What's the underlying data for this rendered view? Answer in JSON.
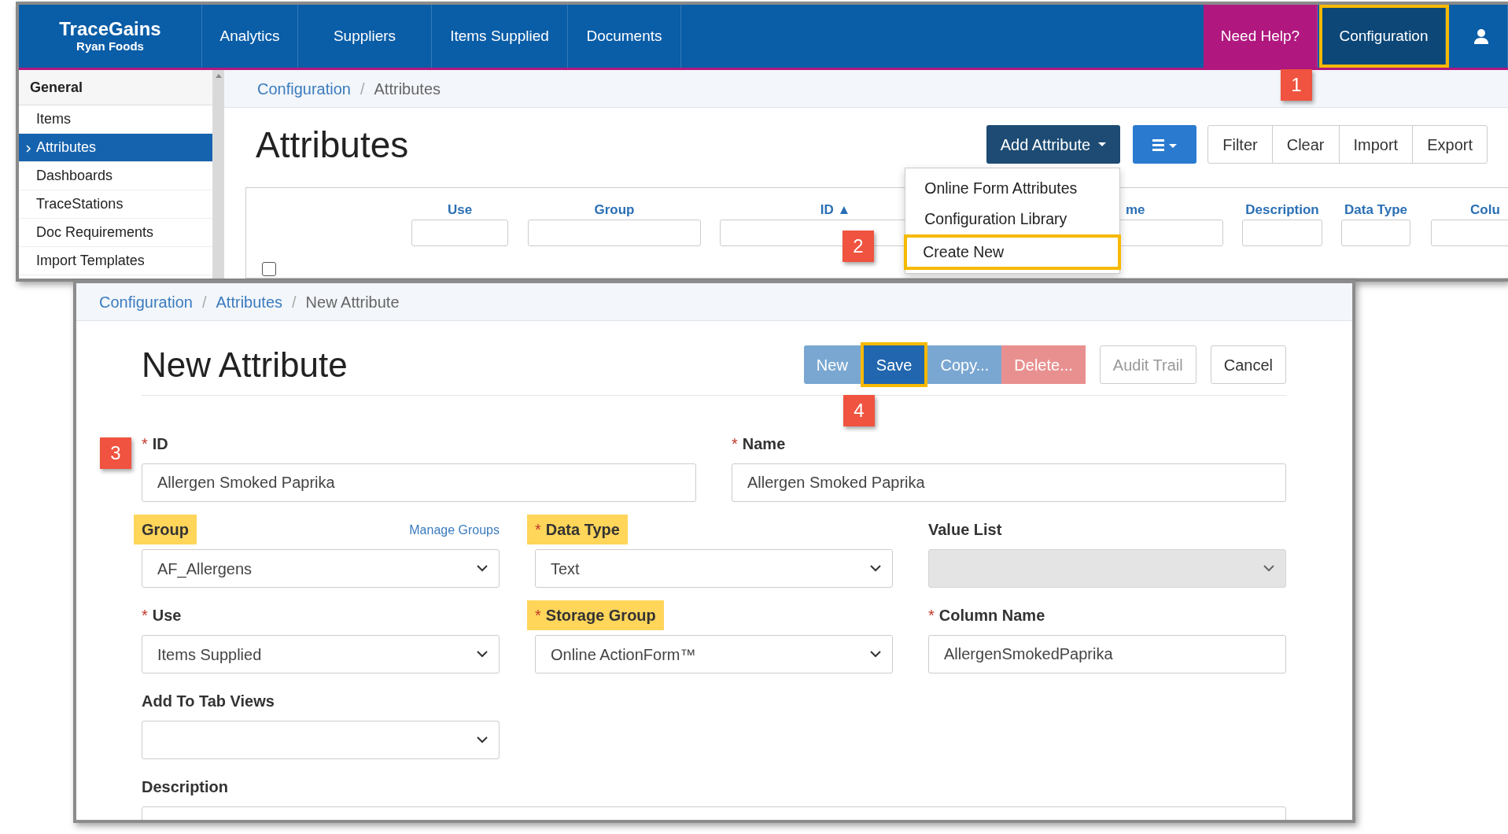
{
  "top_window": {
    "brand": {
      "name": "TraceGains",
      "org": "Ryan Foods"
    },
    "nav": [
      {
        "label": "Analytics"
      },
      {
        "label": "Suppliers"
      },
      {
        "label": "Items Supplied"
      },
      {
        "label": "Documents"
      }
    ],
    "nav_right": [
      {
        "kind": "help",
        "label": "Need Help?",
        "selected": false,
        "highlighted": false
      },
      {
        "kind": "link",
        "label": "Configuration",
        "selected": true,
        "highlighted": true
      },
      {
        "kind": "user",
        "selected": false,
        "highlighted": false
      }
    ],
    "sidebar": {
      "heading": "General",
      "items": [
        {
          "label": "Items",
          "selected": false
        },
        {
          "label": "Attributes",
          "selected": true
        },
        {
          "label": "Dashboards",
          "selected": false
        },
        {
          "label": "TraceStations",
          "selected": false
        },
        {
          "label": "Doc Requirements",
          "selected": false
        },
        {
          "label": "Import Templates",
          "selected": false
        }
      ]
    },
    "breadcrumb": [
      {
        "label": "Configuration",
        "link": true
      },
      {
        "label": "Attributes",
        "link": false
      }
    ],
    "breadcrumb_separator": "/",
    "title": "Attributes",
    "add_button": {
      "label": "Add Attribute",
      "expanded": true
    },
    "menu": [
      {
        "label": "Online Form Attributes",
        "highlighted": false
      },
      {
        "label": "Configuration Library",
        "highlighted": false
      },
      {
        "label": "Create New",
        "highlighted": true
      }
    ],
    "actions": [
      {
        "label": "Filter"
      },
      {
        "label": "Clear"
      },
      {
        "label": "Import"
      },
      {
        "label": "Export"
      }
    ],
    "columns": [
      {
        "label": "Use"
      },
      {
        "label": "Group"
      },
      {
        "label": "ID ▲"
      },
      {
        "label": "me"
      },
      {
        "label": "Description"
      },
      {
        "label": "Data Type"
      },
      {
        "label": "Colu"
      }
    ],
    "select_all": {
      "checked": false
    }
  },
  "form_window": {
    "breadcrumb": [
      {
        "label": "Configuration",
        "link": true
      },
      {
        "label": "Attributes",
        "link": true
      },
      {
        "label": "New Attribute",
        "link": false
      }
    ],
    "breadcrumb_separator": "/",
    "title": "New Attribute",
    "buttons": [
      {
        "label": "New",
        "kind": "primary",
        "disabled": true,
        "highlighted": false
      },
      {
        "label": "Save",
        "kind": "primary",
        "disabled": false,
        "highlighted": true
      },
      {
        "label": "Copy...",
        "kind": "primary",
        "disabled": true,
        "highlighted": false
      },
      {
        "label": "Delete...",
        "kind": "danger",
        "disabled": true,
        "highlighted": false
      },
      {
        "label": "Audit Trail",
        "kind": "default",
        "disabled": true,
        "highlighted": false
      },
      {
        "label": "Cancel",
        "kind": "default",
        "disabled": false,
        "highlighted": false
      }
    ],
    "required_mark": "*",
    "fields": [
      {
        "label": "ID",
        "kind": "input",
        "required": true,
        "highlighted": false,
        "value": "Allergen Smoked Paprika",
        "disabled": false
      },
      {
        "label": "Name",
        "kind": "input",
        "required": true,
        "highlighted": false,
        "value": "Allergen Smoked Paprika",
        "disabled": false
      },
      {
        "label": "Group",
        "kind": "select",
        "required": false,
        "highlighted": true,
        "value": "AF_Allergens",
        "link": "Manage Groups",
        "disabled": false
      },
      {
        "label": "Data Type",
        "kind": "select",
        "required": true,
        "highlighted": true,
        "value": "Text",
        "disabled": false
      },
      {
        "label": "Value List",
        "kind": "select",
        "required": false,
        "highlighted": false,
        "disabled": true
      },
      {
        "label": "Use",
        "kind": "select",
        "required": true,
        "highlighted": false,
        "value": "Items Supplied",
        "disabled": false
      },
      {
        "label": "Storage Group",
        "kind": "select",
        "required": true,
        "highlighted": true,
        "value": "Online ActionForm™",
        "disabled": false
      },
      {
        "label": "Column Name",
        "kind": "input",
        "required": true,
        "highlighted": false,
        "value": "AllergenSmokedPaprika",
        "disabled": false
      },
      {
        "label": "Add To Tab Views",
        "kind": "select",
        "required": false,
        "highlighted": false,
        "disabled": false
      },
      {
        "label": "Description",
        "kind": "textarea",
        "required": false,
        "highlighted": false
      }
    ]
  },
  "callouts": [
    {
      "label": "1"
    },
    {
      "label": "2"
    },
    {
      "label": "3"
    },
    {
      "label": "4"
    }
  ]
}
